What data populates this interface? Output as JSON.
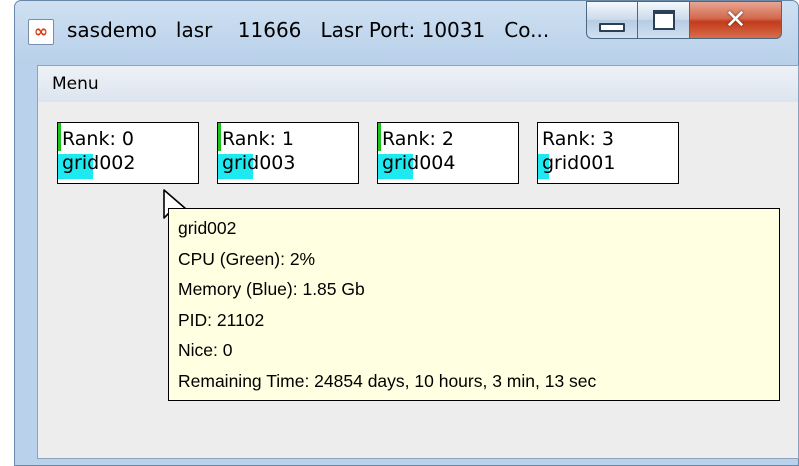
{
  "window": {
    "title": "sasdemo   lasr    11666   Lasr Port: 10031   Co...",
    "icon": "java-icon"
  },
  "menu": {
    "label": "Menu"
  },
  "ranks": [
    {
      "rank_label": "Rank: 0",
      "host": "grid002",
      "cpu_percent": 2,
      "memory_fill": 0.25
    },
    {
      "rank_label": "Rank: 1",
      "host": "grid003",
      "cpu_percent": 2,
      "memory_fill": 0.25
    },
    {
      "rank_label": "Rank: 2",
      "host": "grid004",
      "cpu_percent": 2,
      "memory_fill": 0.25
    },
    {
      "rank_label": "Rank: 3",
      "host": "grid001",
      "cpu_percent": 0,
      "memory_fill": 0.08
    }
  ],
  "tooltip": {
    "host": "grid002",
    "cpu": "CPU (Green): 2%",
    "memory": "Memory (Blue): 1.85 Gb",
    "pid": "PID: 21102",
    "nice": "Nice: 0",
    "remaining": "Remaining Time: 24854 days, 10 hours, 3 min, 13 sec"
  },
  "colors": {
    "cpu": "#1ec21e",
    "memory": "#1ee8f0",
    "tooltip_bg": "#ffffe1"
  }
}
